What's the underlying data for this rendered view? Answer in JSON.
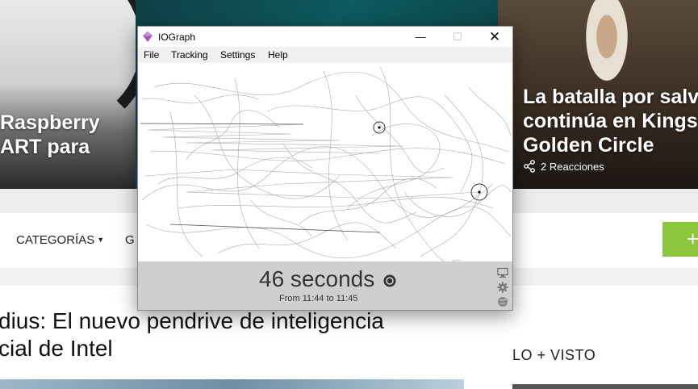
{
  "website": {
    "hero_left_title": [
      "Raspberry",
      "ART para"
    ],
    "hero_right_title": [
      "La batalla por salv",
      "continúa en Kings",
      "Golden Circle"
    ],
    "hero_right_reactions": "2 Reacciones",
    "nav": {
      "categories": "CATEGORÍAS",
      "next": "G",
      "plus": "+"
    },
    "article_title": [
      "dius: El nuevo pendrive de inteligencia",
      "cial de Intel"
    ],
    "sidebar_heading": "LO + VISTO"
  },
  "window": {
    "title": "IOGraph",
    "controls": {
      "minimize": "—",
      "maximize": "☐",
      "close": "✕"
    },
    "menu": [
      "File",
      "Tracking",
      "Settings",
      "Help"
    ],
    "duration": "46 seconds",
    "range": "From 11:44 to 11:45",
    "icons": [
      "monitor-icon",
      "gear-icon",
      "globe-icon"
    ]
  },
  "colors": {
    "accent_green": "#8cc63f",
    "footer_gray": "#cfcfcf",
    "app_icon": "#9b59b6"
  }
}
